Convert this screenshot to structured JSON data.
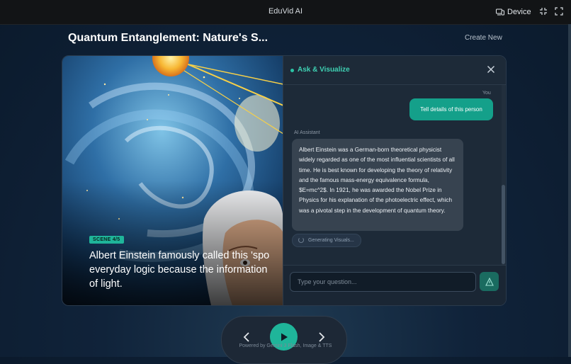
{
  "app": {
    "title": "EduVid AI",
    "device_label": "Device"
  },
  "page": {
    "title": "Quantum Entanglement: Nature's S...",
    "create_new": "Create New"
  },
  "scene": {
    "badge": "SCENE 4/5",
    "caption": "Albert Einstein famously called this 'spo\neveryday logic because the information\nof light."
  },
  "panel": {
    "title": "Ask & Visualize",
    "messages": [
      {
        "role_label": "You",
        "text": "Tell details of this person"
      },
      {
        "role_label": "AI Assistant",
        "text": "Albert Einstein was a German-born theoretical physicist widely regarded as one of the most influential scientists of all time. He is best known for developing the theory of relativity and the famous mass-energy equivalence formula, $E=mc^2$. In 1921, he was awarded the Nobel Prize in Physics for his explanation of the photoelectric effect, which was a pivotal step in the development of quantum theory."
      }
    ],
    "status": "Generating Visuals...",
    "input_placeholder": "Type your question..."
  },
  "footer": {
    "powered_by": "Powered by Gemini 3 Flash, Image & TTS"
  },
  "colors": {
    "accent": "#1fb59a",
    "panel_title": "#3fd1b3",
    "user_bubble": "#14a08a",
    "ai_bubble": "#374350"
  },
  "icons": {
    "device": "device-icon",
    "minimize": "minimize-icon",
    "fullscreen": "fullscreen-icon",
    "close": "close-icon",
    "send": "send-icon",
    "prev": "chevron-left-icon",
    "play": "play-icon",
    "next": "chevron-right-icon"
  }
}
